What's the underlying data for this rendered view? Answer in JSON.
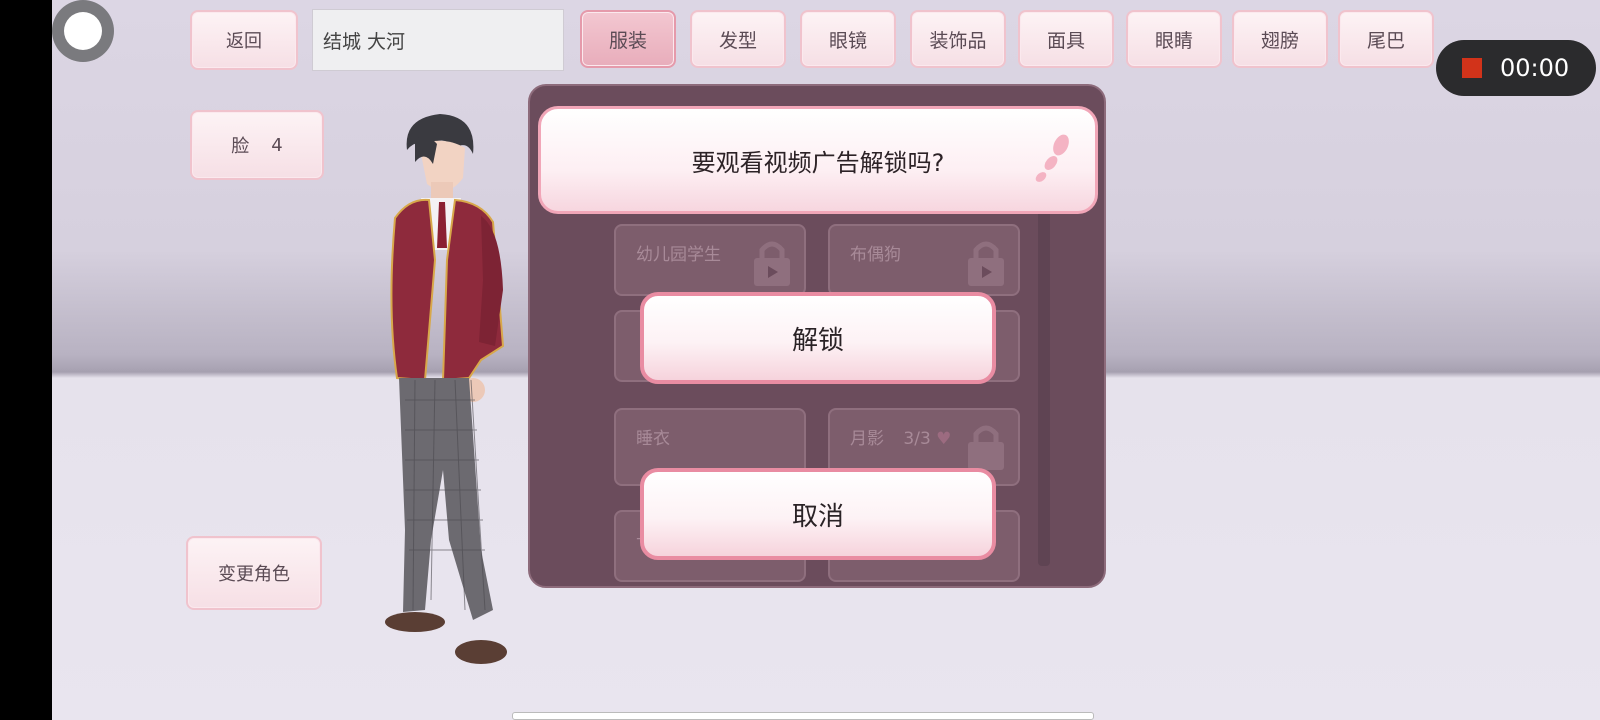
{
  "top_bar": {
    "back_label": "返回",
    "name_value": "结城 大河",
    "tabs": [
      {
        "label": "服装",
        "active": true
      },
      {
        "label": "发型",
        "active": false
      },
      {
        "label": "眼镜",
        "active": false
      },
      {
        "label": "装饰品",
        "active": false
      },
      {
        "label": "面具",
        "active": false
      },
      {
        "label": "眼睛",
        "active": false
      },
      {
        "label": "翅膀",
        "active": false
      },
      {
        "label": "尾巴",
        "active": false
      }
    ]
  },
  "side": {
    "face_label": "脸",
    "face_value": "4",
    "change_character_label": "变更角色"
  },
  "recording": {
    "time": "00:00",
    "color": "#d2331a"
  },
  "background_items": [
    {
      "label": "幼儿园学生"
    },
    {
      "label": "布偶狗"
    },
    {
      "label": "睡衣"
    },
    {
      "label": "月影",
      "count": "3/3"
    },
    {
      "label": "卡"
    }
  ],
  "dialog": {
    "question": "要观看视频广告解锁吗?",
    "unlock_label": "解锁",
    "cancel_label": "取消"
  },
  "colors": {
    "accent_pink": "#e98ca2",
    "dialog_bg": "#6b4c5c"
  }
}
